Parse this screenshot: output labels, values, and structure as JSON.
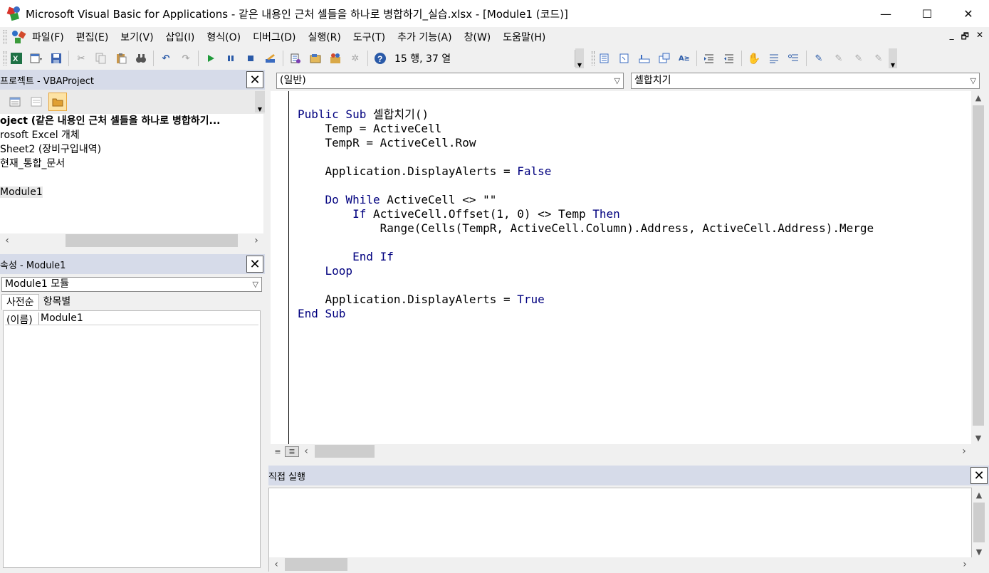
{
  "window": {
    "title": "Microsoft Visual Basic for Applications - 같은 내용인 근처 셀들을 하나로 병합하기_실습.xlsx - [Module1 (코드)]",
    "controls": [
      "—",
      "☐",
      "✕"
    ]
  },
  "menu": {
    "items": [
      "파일(F)",
      "편집(E)",
      "보기(V)",
      "삽입(I)",
      "형식(O)",
      "디버그(D)",
      "실행(R)",
      "도구(T)",
      "추가 기능(A)",
      "창(W)",
      "도움말(H)"
    ],
    "mdi_controls": [
      "_",
      "🗗",
      "✕"
    ]
  },
  "toolbar": {
    "position_text": "15 행, 37 열"
  },
  "project_panel": {
    "title": "프로젝트 - VBAProject",
    "tree": [
      {
        "text": "oject (같은 내용인 근처 셀들을 하나로 병합하기...",
        "bold": true
      },
      {
        "text": "rosoft Excel 개체"
      },
      {
        "text": "Sheet2 (장비구입내역)"
      },
      {
        "text": "현재_통합_문서"
      },
      {
        "text": ""
      },
      {
        "text": "Module1",
        "selected": true
      }
    ]
  },
  "properties_panel": {
    "title": "속성 - Module1",
    "object_select": "Module1 모듈",
    "tabs": [
      "사전순",
      "항목별"
    ],
    "rows": [
      {
        "name": "(이름)",
        "value": "Module1"
      }
    ]
  },
  "code_window": {
    "object_combo": "(일반)",
    "procedure_combo": "셀합치기"
  },
  "immediate_window": {
    "title": "직접 실행"
  }
}
